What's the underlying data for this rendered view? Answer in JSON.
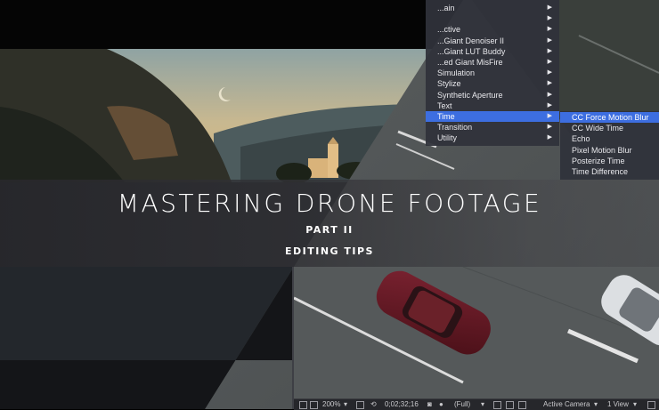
{
  "title": {
    "main": "MASTERING DRONE FOOTAGE",
    "part": "PART II",
    "subtitle": "EDITING TIPS"
  },
  "effect_menu": {
    "items": [
      {
        "label": "...ain",
        "has_submenu": true
      },
      {
        "label": "",
        "has_submenu": true
      },
      {
        "label": "...ctive",
        "has_submenu": true
      },
      {
        "label": "...Giant Denoiser II",
        "has_submenu": true
      },
      {
        "label": "...Giant LUT Buddy",
        "has_submenu": true
      },
      {
        "label": "...ed Giant MisFire",
        "has_submenu": true
      },
      {
        "label": "Simulation",
        "has_submenu": true
      },
      {
        "label": "Stylize",
        "has_submenu": true
      },
      {
        "label": "Synthetic Aperture",
        "has_submenu": true
      },
      {
        "label": "Text",
        "has_submenu": true
      },
      {
        "label": "Time",
        "has_submenu": true,
        "highlighted": true
      },
      {
        "label": "Transition",
        "has_submenu": true
      },
      {
        "label": "Utility",
        "has_submenu": true
      }
    ]
  },
  "time_submenu": {
    "items": [
      {
        "label": "CC Force Motion Blur",
        "highlighted": true
      },
      {
        "label": "CC Wide Time"
      },
      {
        "label": "Echo"
      },
      {
        "label": "Pixel Motion Blur"
      },
      {
        "label": "Posterize Time"
      },
      {
        "label": "Time Difference"
      }
    ]
  },
  "toolbar": {
    "zoom": "200%",
    "timecode": "0;02;32;16",
    "resolution": "(Full)",
    "camera": "Active Camera",
    "views": "1 View"
  },
  "colors": {
    "menu_bg": "#30323a",
    "menu_highlight": "#3d6ee0",
    "menu_text": "#e8e8ec"
  }
}
